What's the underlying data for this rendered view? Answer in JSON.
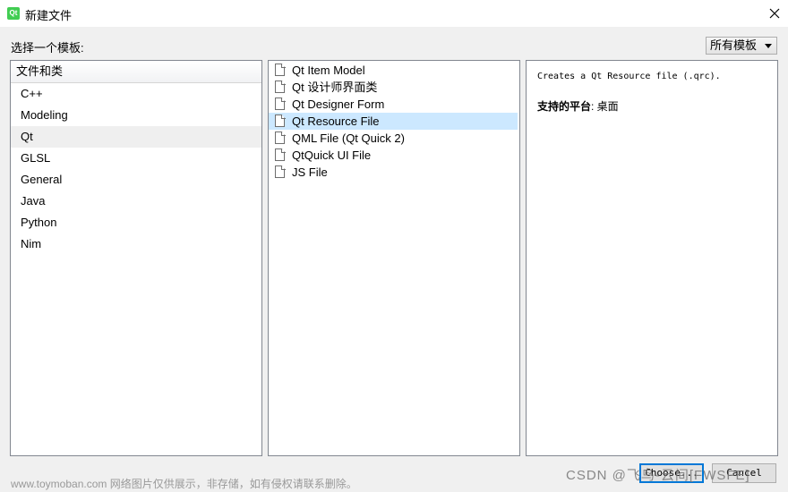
{
  "window": {
    "title": "新建文件",
    "app_icon_text": "Qt",
    "accent_color": "#0078d7"
  },
  "prompt_label": "选择一个模板:",
  "filter": {
    "selected": "所有模板"
  },
  "categories": {
    "header": "文件和类",
    "items": [
      {
        "label": "C++"
      },
      {
        "label": "Modeling"
      },
      {
        "label": "Qt",
        "selected": true
      },
      {
        "label": "GLSL"
      },
      {
        "label": "General"
      },
      {
        "label": "Java"
      },
      {
        "label": "Python"
      },
      {
        "label": "Nim"
      }
    ]
  },
  "templates": {
    "items": [
      {
        "label": "Qt Item Model"
      },
      {
        "label": "Qt 设计师界面类"
      },
      {
        "label": "Qt Designer Form"
      },
      {
        "label": "Qt Resource File",
        "selected": true
      },
      {
        "label": "QML File (Qt Quick 2)"
      },
      {
        "label": "QtQuick UI File"
      },
      {
        "label": "JS File"
      }
    ]
  },
  "description": {
    "text": "Creates a Qt Resource file (.qrc).",
    "platform_label": "支持的平台",
    "platform_value": ": 桌面"
  },
  "buttons": {
    "choose": "Choose...",
    "cancel": "Cancel"
  },
  "watermark": "www.toymoban.com 网络图片仅供展示，非存储，如有侵权请联系删除。",
  "credit": "CSDN @飞鸟-云间[FWSFE]"
}
